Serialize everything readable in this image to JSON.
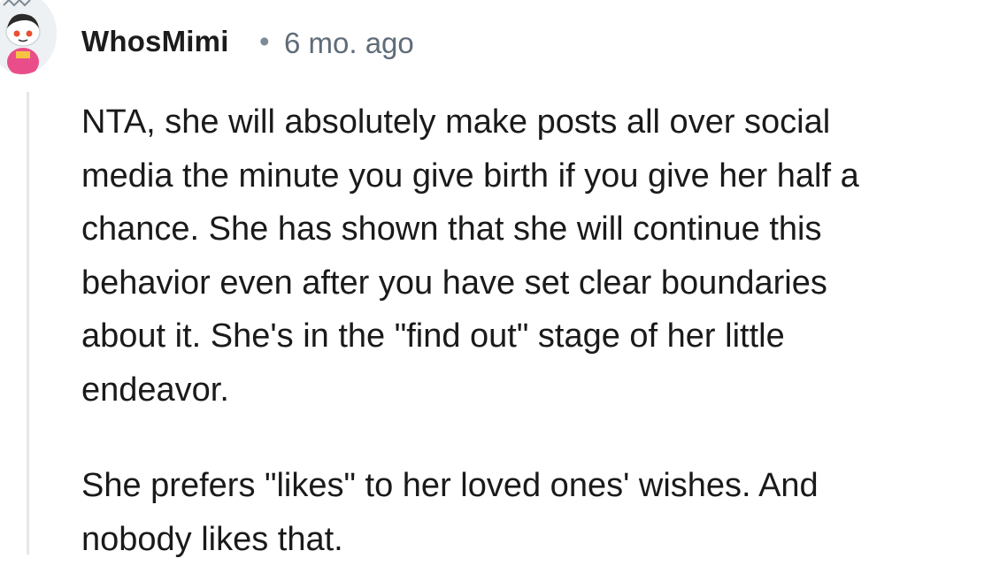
{
  "comment": {
    "author": "WhosMimi",
    "separator": "•",
    "age": "6 mo. ago",
    "avatar_icon": "snoo-avatar-icon",
    "paragraphs": [
      "NTA, she will absolutely make posts all over social\nmedia the minute you give birth if you give her half a\nchance. She has shown that she will continue this\nbehavior even after you have set clear boundaries\nabout it. She's in the \"find out\" stage of her little\nendeavor.",
      "She prefers \"likes\" to her loved ones' wishes. And\nnobody likes that."
    ]
  },
  "colors": {
    "text": "#1a1a1b",
    "meta": "#5f6c78",
    "thread_line": "#e4e7ea",
    "background": "#ffffff"
  }
}
